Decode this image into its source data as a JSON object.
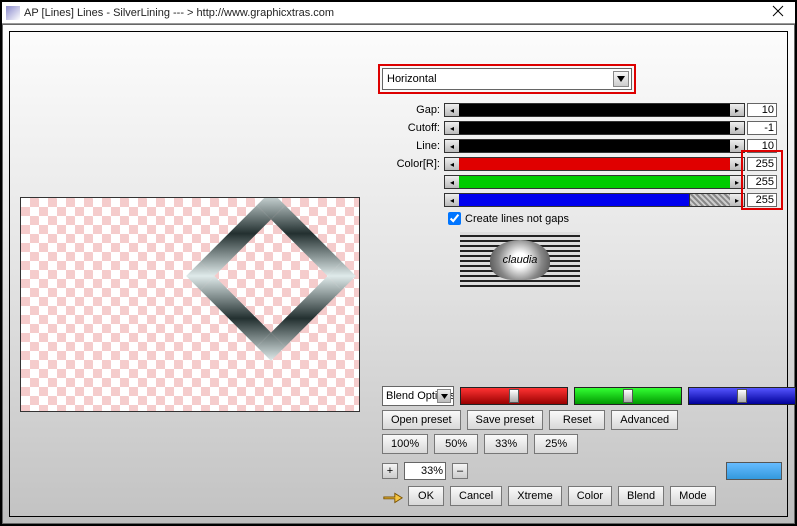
{
  "window": {
    "title": "AP [Lines]  Lines - SilverLining   --- >  http://www.graphicxtras.com"
  },
  "controls": {
    "direction_selected": "Horizontal",
    "sliders": {
      "gap": {
        "label": "Gap:",
        "value": "10"
      },
      "cutoff": {
        "label": "Cutoff:",
        "value": "-1"
      },
      "line": {
        "label": "Line:",
        "value": "10"
      },
      "r": {
        "label": "Color[R]:",
        "value": "255"
      },
      "g": {
        "label": "",
        "value": "255"
      },
      "b": {
        "label": "",
        "value": "255"
      }
    },
    "checkbox_label": "Create lines not gaps",
    "checkbox_checked": true,
    "logo_text": "claudia"
  },
  "blend": {
    "dropdown": "Blend Options"
  },
  "buttons": {
    "open_preset": "Open preset",
    "save_preset": "Save preset",
    "reset": "Reset",
    "advanced": "Advanced",
    "p100": "100%",
    "p50": "50%",
    "p33": "33%",
    "p25": "25%",
    "ok": "OK",
    "cancel": "Cancel",
    "xtreme": "Xtreme",
    "color": "Color",
    "blend": "Blend",
    "mode": "Mode"
  },
  "percent": {
    "plus": "+",
    "minus": "–",
    "value": "33%"
  }
}
